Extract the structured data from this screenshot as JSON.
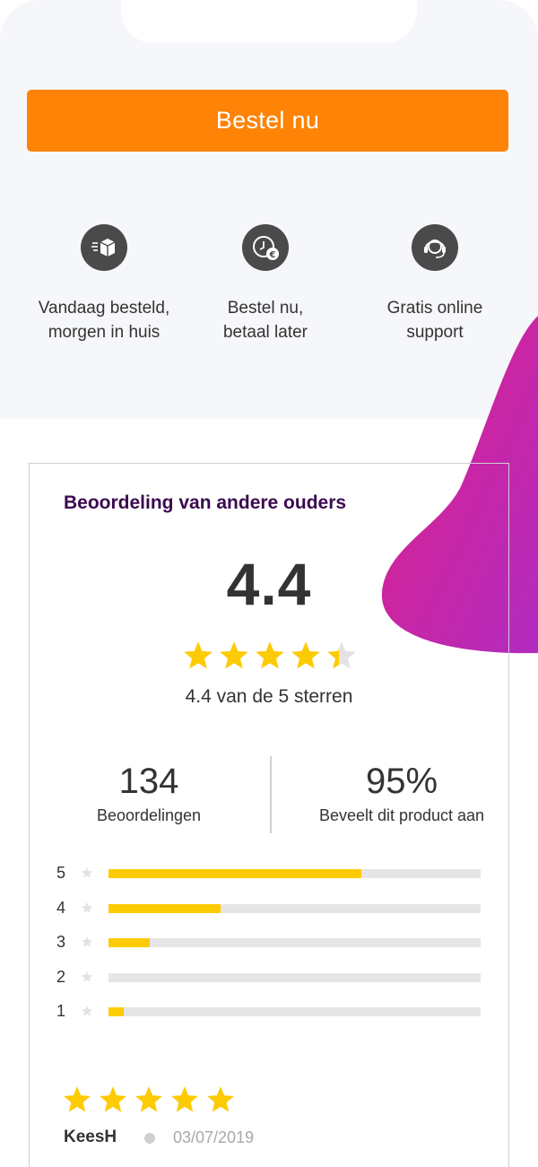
{
  "colors": {
    "order_button": "#fe8306",
    "panel_background": "#f6f7fa",
    "icon_circle": "#4a4a4a",
    "title_purple": "#3b0a4f",
    "star_yellow": "#fdcb04",
    "bar_track": "#e5e5e5",
    "blob_gradient": [
      "#e0208a",
      "#b22bbf"
    ]
  },
  "order_button": {
    "label": "Bestel nu"
  },
  "usps": [
    {
      "icon": "package-delivery-icon",
      "label": "Vandaag besteld,\nmorgen in huis"
    },
    {
      "icon": "clock-euro-icon",
      "label": "Bestel nu,\nbetaal later"
    },
    {
      "icon": "headset-support-icon",
      "label": "Gratis online\nsupport"
    }
  ],
  "reviews": {
    "title": "Beoordeling van andere ouders",
    "average": "4.4",
    "average_value": 4.4,
    "max_stars": 5,
    "score_text": "4.4 van de 5 sterren",
    "count": "134",
    "count_label": "Beoordelingen",
    "recommend": "95%",
    "recommend_label": "Beveelt dit product aan",
    "distribution": [
      {
        "stars": "5",
        "fraction": 0.68
      },
      {
        "stars": "4",
        "fraction": 0.3
      },
      {
        "stars": "3",
        "fraction": 0.11
      },
      {
        "stars": "2",
        "fraction": 0.0
      },
      {
        "stars": "1",
        "fraction": 0.04
      }
    ],
    "latest": {
      "rating": 5,
      "author": "KeesH",
      "date": "03/07/2019"
    }
  }
}
